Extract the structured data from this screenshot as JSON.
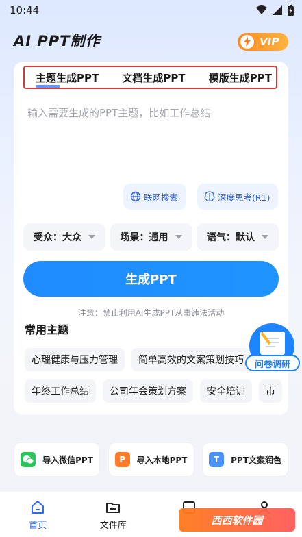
{
  "status_bar": {
    "time": "10:44"
  },
  "header": {
    "title": "AI PPT制作",
    "vip_label": "VIP"
  },
  "tabs": [
    {
      "label": "主题生成PPT",
      "active": true
    },
    {
      "label": "文档生成PPT",
      "active": false
    },
    {
      "label": "模版生成PPT",
      "active": false
    }
  ],
  "prompt": {
    "placeholder": "输入需要生成的PPT主题，比如工作总结",
    "value": ""
  },
  "options": {
    "web_search": "联网搜索",
    "deep_think": "深度思考(R1)"
  },
  "selects": [
    {
      "label": "受众：大众"
    },
    {
      "label": "场景：通用"
    },
    {
      "label": "语气：默认"
    }
  ],
  "generate_button": "生成PPT",
  "notice": "注意：禁止利用AI生成PPT从事违法活动",
  "topics_section": {
    "title": "常用主题",
    "rows": [
      [
        "心理健康与压力管理",
        "简单高效的文案策划技巧"
      ],
      [
        "年终工作总结",
        "公司年会策划方案",
        "安全培训",
        "市"
      ]
    ]
  },
  "survey": {
    "label": "问卷调研"
  },
  "quick_actions": [
    {
      "label": "导入微信PPT",
      "icon": "wechat-icon",
      "color": "#2bc45a"
    },
    {
      "label": "导入本地PPT",
      "icon": "ppt-file-icon",
      "color": "#ff7a2a",
      "glyph": "P"
    },
    {
      "label": "PPT文案润色",
      "icon": "text-icon",
      "color": "#4a90ff",
      "glyph": "T"
    }
  ],
  "nav": [
    {
      "label": "首页",
      "icon": "home-icon",
      "active": true
    },
    {
      "label": "文件库",
      "icon": "folder-icon",
      "active": false
    },
    {
      "label": "",
      "icon": "template-icon",
      "active": false
    },
    {
      "label": "",
      "icon": "profile-icon",
      "active": false
    }
  ],
  "watermark": "西西软件园"
}
